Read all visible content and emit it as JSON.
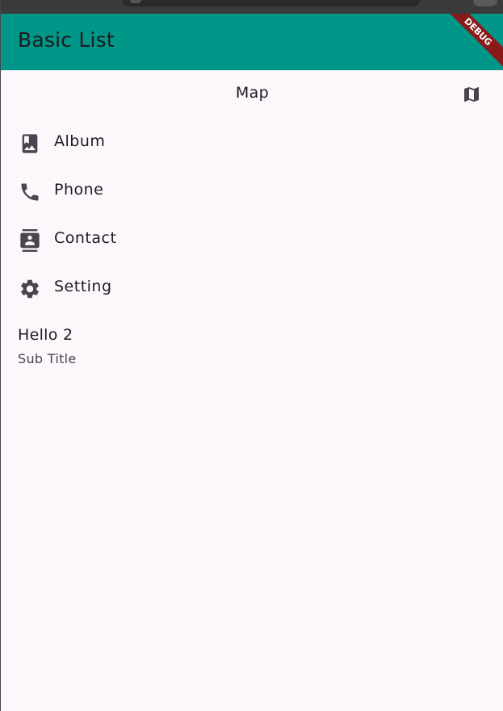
{
  "appbar": {
    "title": "Basic List",
    "color": "#009688"
  },
  "debug_banner": {
    "label": "DEBUG"
  },
  "list": {
    "map_tile": {
      "label": "Map",
      "trailing_icon": "map-icon"
    },
    "items": [
      {
        "label": "Album",
        "icon": "photo-album-icon"
      },
      {
        "label": "Phone",
        "icon": "phone-icon"
      },
      {
        "label": "Contact",
        "icon": "contacts-icon"
      },
      {
        "label": "Setting",
        "icon": "settings-icon"
      }
    ],
    "two_line": {
      "title": "Hello 2",
      "subtitle": "Sub Title"
    }
  },
  "colors": {
    "background": "#fdf7fc",
    "text": "#1d1b20",
    "icon": "#49454f",
    "debug_ribbon": "#8a1a1a"
  }
}
